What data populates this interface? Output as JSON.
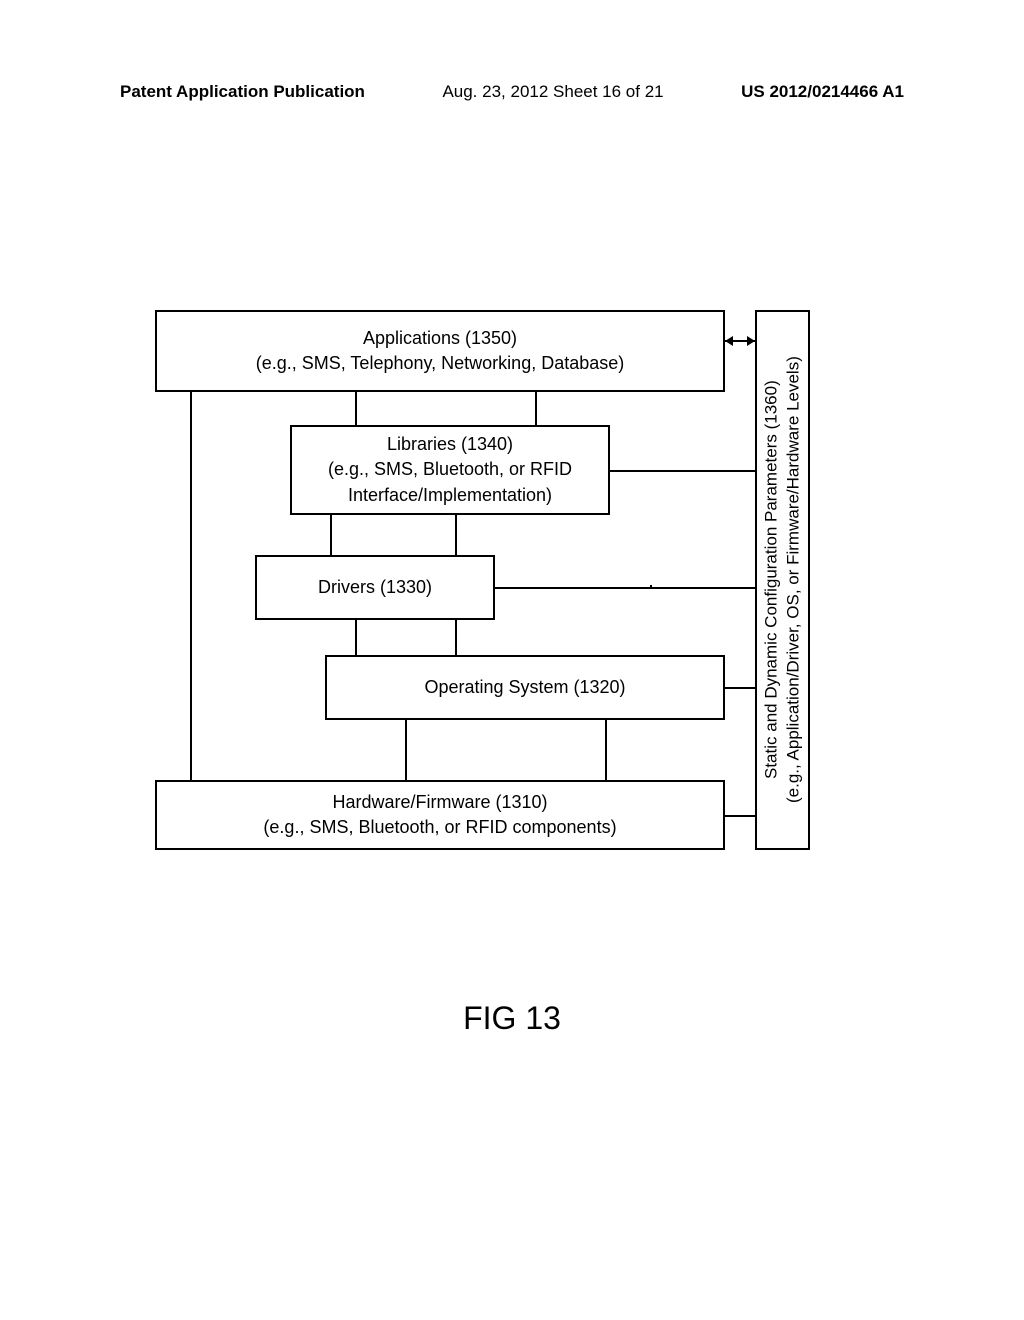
{
  "header": {
    "left": "Patent Application Publication",
    "center": "Aug. 23, 2012  Sheet 16 of 21",
    "right": "US 2012/0214466 A1"
  },
  "boxes": {
    "applications": {
      "line1": "Applications (1350)",
      "line2": "(e.g., SMS, Telephony, Networking, Database)"
    },
    "libraries": {
      "line1": "Libraries (1340)",
      "line2": "(e.g., SMS, Bluetooth, or RFID",
      "line3": "Interface/Implementation)"
    },
    "drivers": {
      "line1": "Drivers (1330)"
    },
    "os": {
      "line1": "Operating System (1320)"
    },
    "hardware": {
      "line1": "Hardware/Firmware (1310)",
      "line2": "(e.g., SMS, Bluetooth, or RFID components)"
    },
    "params": {
      "line1": "Static and Dynamic Configuration Parameters (1360)",
      "line2": "(e.g., Application/Driver, OS, or Firmware/Hardware Levels)"
    }
  },
  "figure_label": "FIG 13"
}
